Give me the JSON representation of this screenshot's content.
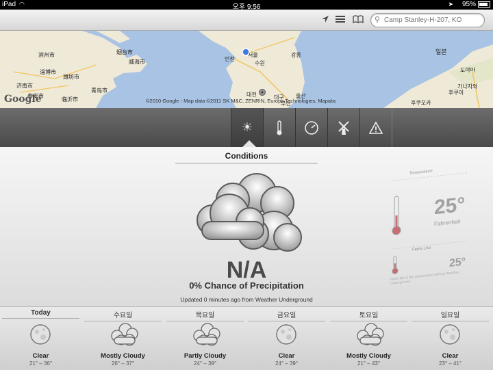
{
  "status_bar": {
    "device": "iPad",
    "time": "오후 9:56",
    "battery": "95%"
  },
  "search": {
    "placeholder": "Camp Stanley-H-207, KO"
  },
  "map": {
    "google_label": "Google",
    "copyright": "©2010 Google - Map data ©2011 SK M&C, ZENRIN, Europa Technologies, Mapabc",
    "labels": [
      "滨州市",
      "烟台市",
      "威海市",
      "淄博市",
      "潍坊市",
      "济南市",
      "青岛市",
      "泰安市",
      "临沂市",
      "서울",
      "인천",
      "수원",
      "대전",
      "대구",
      "울산",
      "부산",
      "강릉",
      "일본",
      "도야마",
      "후쿠이",
      "가나자와",
      "후쿠오카"
    ]
  },
  "tabs": [
    {
      "name": "conditions",
      "icon": "sun-icon"
    },
    {
      "name": "temperature",
      "icon": "thermometer-icon"
    },
    {
      "name": "pressure",
      "icon": "gauge-icon"
    },
    {
      "name": "wind",
      "icon": "windmill-icon"
    },
    {
      "name": "alerts",
      "icon": "warning-icon"
    }
  ],
  "conditions": {
    "title": "Conditions",
    "value": "N/A",
    "precipitation": "0% Chance of Precipitation",
    "updated": "Updated 0 minutes ago from Weather Underground"
  },
  "side_panel": {
    "temperature_label": "Temperature",
    "temperature_value": "25°",
    "temperature_unit": "Fahrenheit",
    "feels_like_label": "Feels Like",
    "feels_like_value": "25°",
    "feels_like_note": "Feels like is the temperature without Weather Underground"
  },
  "forecast": [
    {
      "day": "Today",
      "condition": "Clear",
      "range": "21° – 36°",
      "icon": "moon-icon"
    },
    {
      "day": "수요일",
      "condition": "Mostly Cloudy",
      "range": "26° – 37°",
      "icon": "cloud-icon"
    },
    {
      "day": "목요일",
      "condition": "Partly Cloudy",
      "range": "24° – 39°",
      "icon": "cloud-icon"
    },
    {
      "day": "금요일",
      "condition": "Clear",
      "range": "24° – 39°",
      "icon": "moon-icon"
    },
    {
      "day": "토요일",
      "condition": "Mostly Cloudy",
      "range": "21° – 43°",
      "icon": "cloud-icon"
    },
    {
      "day": "일요일",
      "condition": "Clear",
      "range": "23° – 41°",
      "icon": "moon-icon"
    }
  ]
}
